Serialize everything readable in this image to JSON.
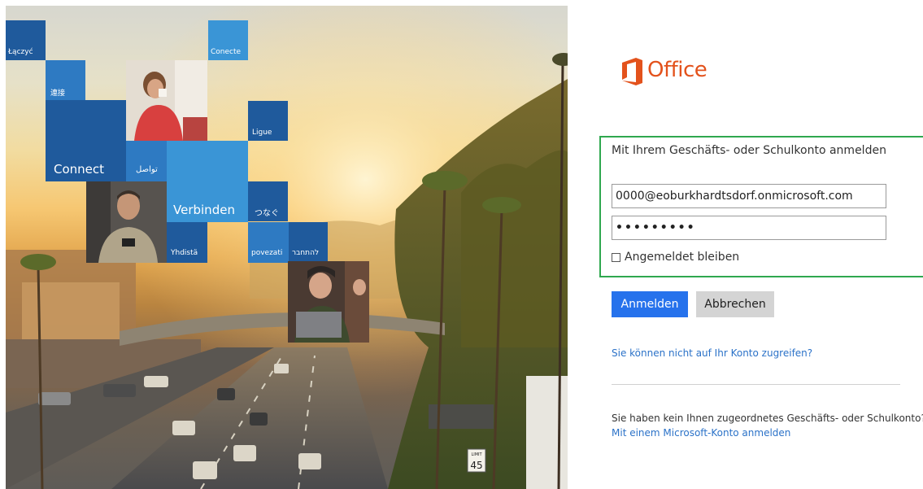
{
  "hero": {
    "tile_words": {
      "laczyc": "Łączyć",
      "conecte": "Conecte",
      "lianjie": "連接",
      "ligue": "Ligue",
      "connect": "Connect",
      "arabic": "تواصل",
      "verbinden": "Verbinden",
      "tsunagu": "つなぐ",
      "yhdista": "Yhdistä",
      "povezati": "povezati",
      "hebrew": "להתחבר"
    },
    "speed_sign": {
      "top": "LIMIT",
      "value": "45"
    },
    "tile_colors": {
      "dark": "#1f5a9c",
      "mid": "#2e7ac2",
      "light": "#3a95d6"
    }
  },
  "brand": {
    "logo_text": "Office",
    "logo_color": "#e3521c",
    "icon": "office-logo-icon"
  },
  "signin": {
    "title": "Mit Ihrem Geschäfts- oder Schulkonto anmelden",
    "email_value": "0000@eoburkhardtsdorf.onmicrosoft.com",
    "password_value": "•••••••••",
    "keep_signed_in_label": "Angemeldet bleiben",
    "keep_signed_in_checked": false,
    "signin_button": "Anmelden",
    "cancel_button": "Abbrechen",
    "cant_access_link": "Sie können nicht auf Ihr Konto zugreifen?",
    "no_account_text": "Sie haben kein Ihnen zugeordnetes Geschäfts- oder Schulkonto?",
    "ms_account_link": "Mit einem Microsoft-Konto anmelden",
    "highlight_color": "#2fa84f",
    "primary_color": "#2672ec"
  }
}
